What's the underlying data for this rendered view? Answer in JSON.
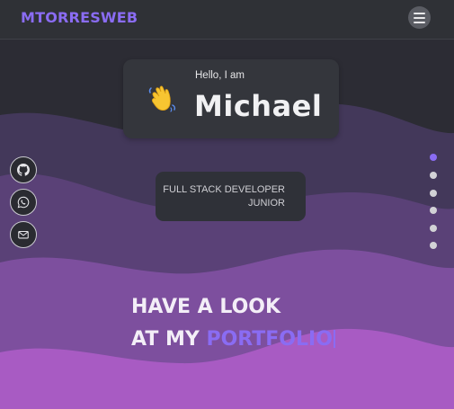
{
  "navbar": {
    "brand": "MTORRESWEB",
    "brand_color": "#8a6cf3",
    "menu_icon": "hamburger-icon"
  },
  "hero": {
    "greeting": "Hello, I am",
    "name": "Michael",
    "greeting_icon": "waving-hand-icon",
    "role_line1": "FULL STACK DEVELOPER",
    "role_line2": "JUNIOR"
  },
  "social_links": [
    {
      "name": "github",
      "icon": "github-icon"
    },
    {
      "name": "whatsapp",
      "icon": "whatsapp-icon"
    },
    {
      "name": "email",
      "icon": "mail-icon"
    }
  ],
  "section_dots": {
    "count": 6,
    "active_index": 0,
    "active_color": "#8a6cf3",
    "inactive_color": "#d2d2d6"
  },
  "tagline": {
    "line1": "HAVE A LOOK",
    "line2_prefix": "AT MY",
    "line2_highlight": "PORTFOLIO"
  },
  "colors": {
    "accent": "#8a6cf3",
    "background_top": "#2b2b33",
    "wave_dark": "#4a3b62",
    "wave_mid": "#6b4a8a",
    "wave_light": "#9a5fb4",
    "wave_bottom": "#b664cc"
  }
}
